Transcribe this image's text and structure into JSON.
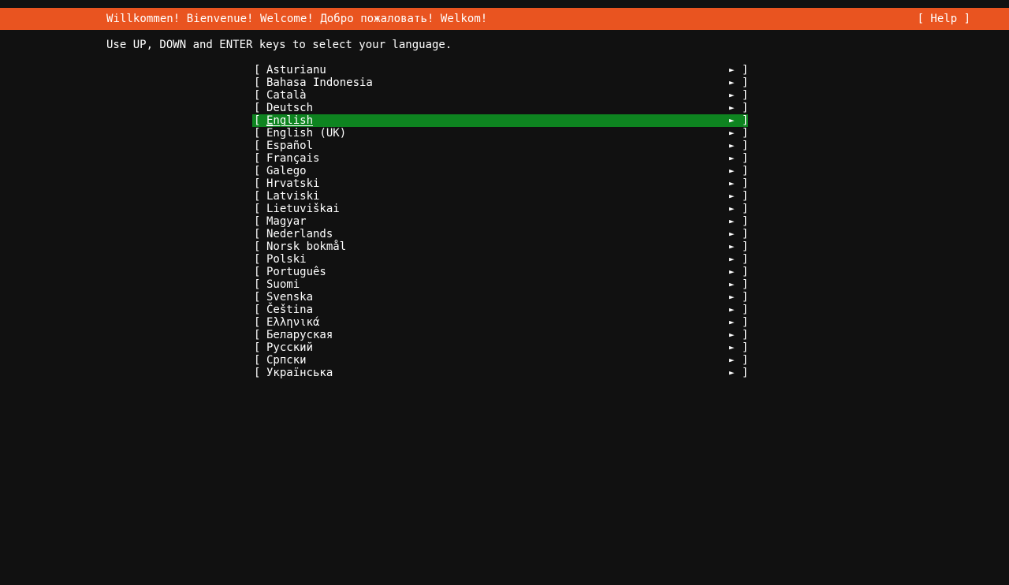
{
  "screen": {
    "background_color": "#111111",
    "text_color": "#ffffff"
  },
  "header": {
    "title": "Willkommen! Bienvenue! Welcome! Добро пожаловать! Welkom!",
    "help_label": "[ Help ]",
    "background_color": "#e95420"
  },
  "instruction": {
    "text": "Use UP, DOWN and ENTER keys to select your language."
  },
  "list": {
    "bracket_open": "[",
    "bracket_close": "]",
    "arrow_glyph": "►",
    "selected_index": 4,
    "selected_color": "#0e8420",
    "items": [
      {
        "label": "Asturianu"
      },
      {
        "label": "Bahasa Indonesia"
      },
      {
        "label": "Català"
      },
      {
        "label": "Deutsch"
      },
      {
        "label": "English"
      },
      {
        "label": "English (UK)"
      },
      {
        "label": "Español"
      },
      {
        "label": "Français"
      },
      {
        "label": "Galego"
      },
      {
        "label": "Hrvatski"
      },
      {
        "label": "Latviski"
      },
      {
        "label": "Lietuviškai"
      },
      {
        "label": "Magyar"
      },
      {
        "label": "Nederlands"
      },
      {
        "label": "Norsk bokmål"
      },
      {
        "label": "Polski"
      },
      {
        "label": "Português"
      },
      {
        "label": "Suomi"
      },
      {
        "label": "Svenska"
      },
      {
        "label": "Čeština"
      },
      {
        "label": "Ελληνικά"
      },
      {
        "label": "Беларуская"
      },
      {
        "label": "Русский"
      },
      {
        "label": "Српски"
      },
      {
        "label": "Українська"
      }
    ]
  }
}
